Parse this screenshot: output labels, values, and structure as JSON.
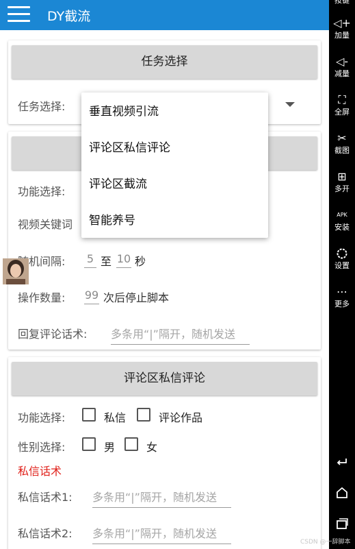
{
  "app": {
    "title": "DY截流"
  },
  "card1": {
    "button": "任务选择",
    "task_label": "任务选择:"
  },
  "dropdown": {
    "options": [
      "垂直视频引流",
      "评论区私信评论",
      "评论区截流",
      "智能养号"
    ]
  },
  "card2": {
    "func_label": "功能选择:",
    "keyword_label": "视频关键词",
    "interval": {
      "label": "随机间隔:",
      "min": "5",
      "sep": "至",
      "max": "10",
      "unit": "秒"
    },
    "count": {
      "label": "操作数量:",
      "value": "99",
      "suffix": "次后停止脚本"
    },
    "reply": {
      "label": "回复评论话术:",
      "placeholder": "多条用“|”隔开，随机发送"
    }
  },
  "card3": {
    "button": "评论区私信评论",
    "func_label": "功能选择:",
    "func_options": [
      "私信",
      "评论作品"
    ],
    "gender_label": "性别选择:",
    "gender_options": [
      "男",
      "女"
    ],
    "dm_title": "私信话术",
    "dm1": {
      "label": "私信话术1:",
      "placeholder": "多条用“|”隔开，随机发送"
    },
    "dm2": {
      "label": "私信话术2:",
      "placeholder": "多条用“|”隔开，随机发送"
    }
  },
  "sidebar": {
    "items": [
      {
        "icon": "keyboard-icon",
        "label": "按键"
      },
      {
        "icon": "volume-up-icon",
        "label": "加量"
      },
      {
        "icon": "volume-down-icon",
        "label": "减量"
      },
      {
        "icon": "fullscreen-icon",
        "label": "全屏"
      },
      {
        "icon": "scissors-icon",
        "label": "截图"
      },
      {
        "icon": "multi-window-icon",
        "label": "多开"
      },
      {
        "icon": "apk-install-icon",
        "label": "安装"
      },
      {
        "icon": "settings-icon",
        "label": "设置"
      },
      {
        "icon": "more-icon",
        "label": "更多"
      }
    ],
    "nav": [
      "back-icon",
      "home-icon",
      "recent-apps-icon"
    ],
    "icon_glyphs": {
      "volume_up": "◁+",
      "volume_down": "◁-",
      "fullscreen": "⛶",
      "scissors": "✂",
      "multi": "⊞",
      "apk": "APK",
      "more": "⋯"
    }
  },
  "watermark": "CSDN @一辞脚本",
  "colors": {
    "header": "#1b87d4",
    "section_button": "#d8d8d8",
    "accent_red": "#e0201a",
    "sidebar": "#000000"
  }
}
